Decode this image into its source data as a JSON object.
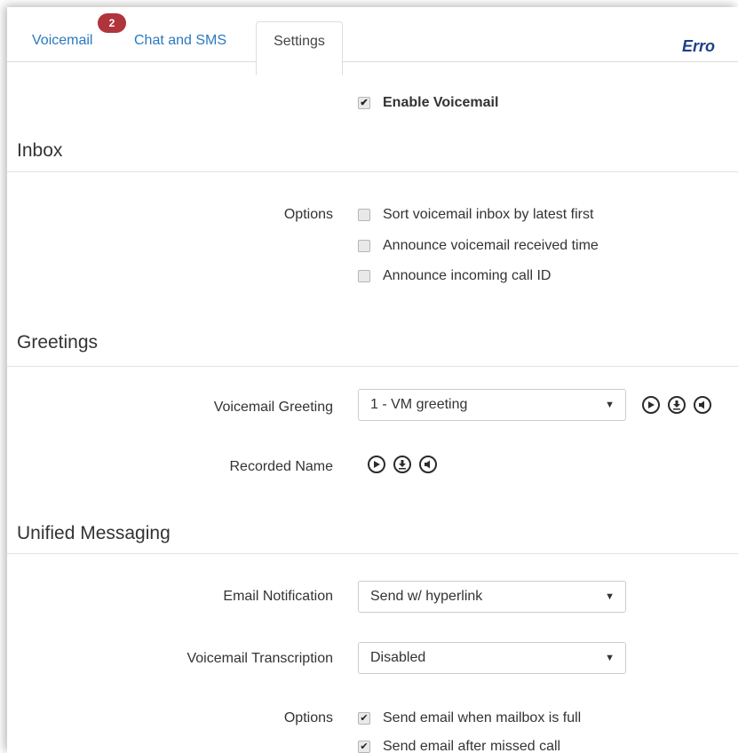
{
  "tabs": [
    {
      "label": "Voicemail",
      "badge": "2"
    },
    {
      "label": "Chat and SMS"
    },
    {
      "label": "Settings"
    }
  ],
  "error_text": "Erro",
  "enable_voicemail": {
    "label": "Enable Voicemail",
    "checked": true
  },
  "inbox": {
    "title": "Inbox",
    "options_label": "Options",
    "options": [
      {
        "label": "Sort voicemail inbox by latest first",
        "checked": false
      },
      {
        "label": "Announce voicemail received time",
        "checked": false
      },
      {
        "label": "Announce incoming call ID",
        "checked": false
      }
    ]
  },
  "greetings": {
    "title": "Greetings",
    "voicemail_greeting_label": "Voicemail Greeting",
    "voicemail_greeting_value": "1 - VM greeting",
    "recorded_name_label": "Recorded Name",
    "icons": [
      "play-icon",
      "download-icon",
      "speaker-icon"
    ]
  },
  "unified": {
    "title": "Unified Messaging",
    "email_notification_label": "Email Notification",
    "email_notification_value": "Send w/ hyperlink",
    "transcription_label": "Voicemail Transcription",
    "transcription_value": "Disabled",
    "options_label": "Options",
    "options": [
      {
        "label": "Send email when mailbox is full",
        "checked": true
      },
      {
        "label": "Send email after missed call",
        "checked": true
      }
    ]
  },
  "colors": {
    "tab_link": "#2a79c0",
    "badge": "#b0343c",
    "error": "#1f3f87"
  }
}
